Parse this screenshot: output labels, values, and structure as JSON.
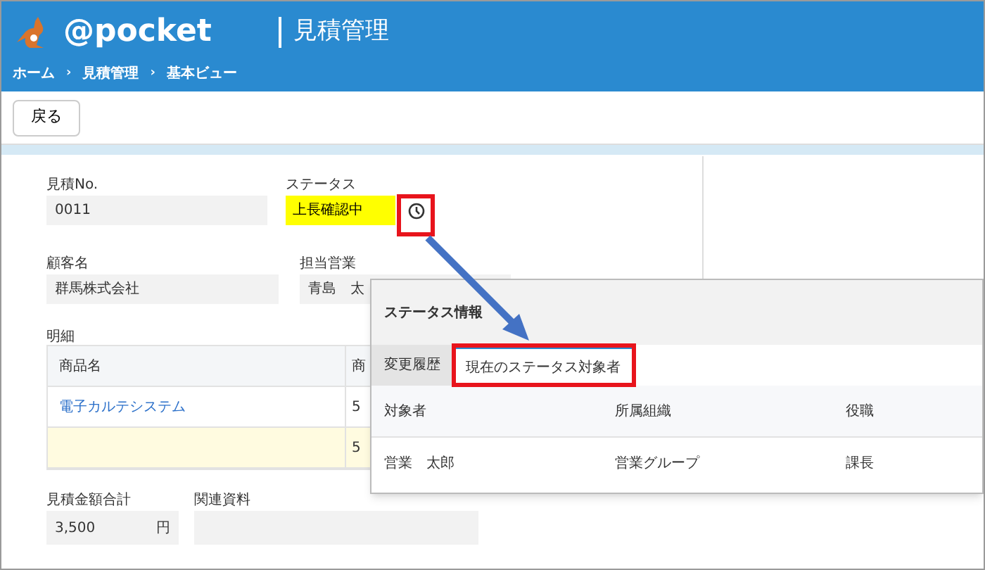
{
  "header": {
    "logo": "@pocket",
    "title": "見積管理",
    "breadcrumb": [
      "ホーム",
      "見積管理",
      "基本ビュー"
    ],
    "breadcrumb_separator": "›"
  },
  "toolbar": {
    "back_button": "戻る"
  },
  "form": {
    "estimate_no": {
      "label": "見積No.",
      "value": "0011"
    },
    "status": {
      "label": "ステータス",
      "value": "上長確認中"
    },
    "customer": {
      "label": "顧客名",
      "value": "群馬株式会社"
    },
    "sales_rep": {
      "label": "担当営業",
      "value": "青島　太"
    }
  },
  "details": {
    "label": "明細",
    "columns": [
      "商品名",
      "商"
    ],
    "rows": [
      {
        "cells": [
          "電子カルテシステム",
          "5"
        ],
        "highlighted": false
      },
      {
        "cells": [
          "",
          "5"
        ],
        "highlighted": true
      }
    ]
  },
  "total": {
    "label": "見積金額合計",
    "value": "3,500",
    "unit": "円"
  },
  "related": {
    "label": "関連資料"
  },
  "popup": {
    "title": "ステータス情報",
    "tabs": [
      {
        "label": "変更履歴",
        "selected": false,
        "highlighted": false
      },
      {
        "label": "現在のステータス対象者",
        "selected": true,
        "highlighted": true
      }
    ],
    "columns": [
      "対象者",
      "所属組織",
      "役職"
    ],
    "rows": [
      {
        "cells": [
          "営業　太郎",
          "営業グループ",
          "課長"
        ]
      }
    ]
  }
}
